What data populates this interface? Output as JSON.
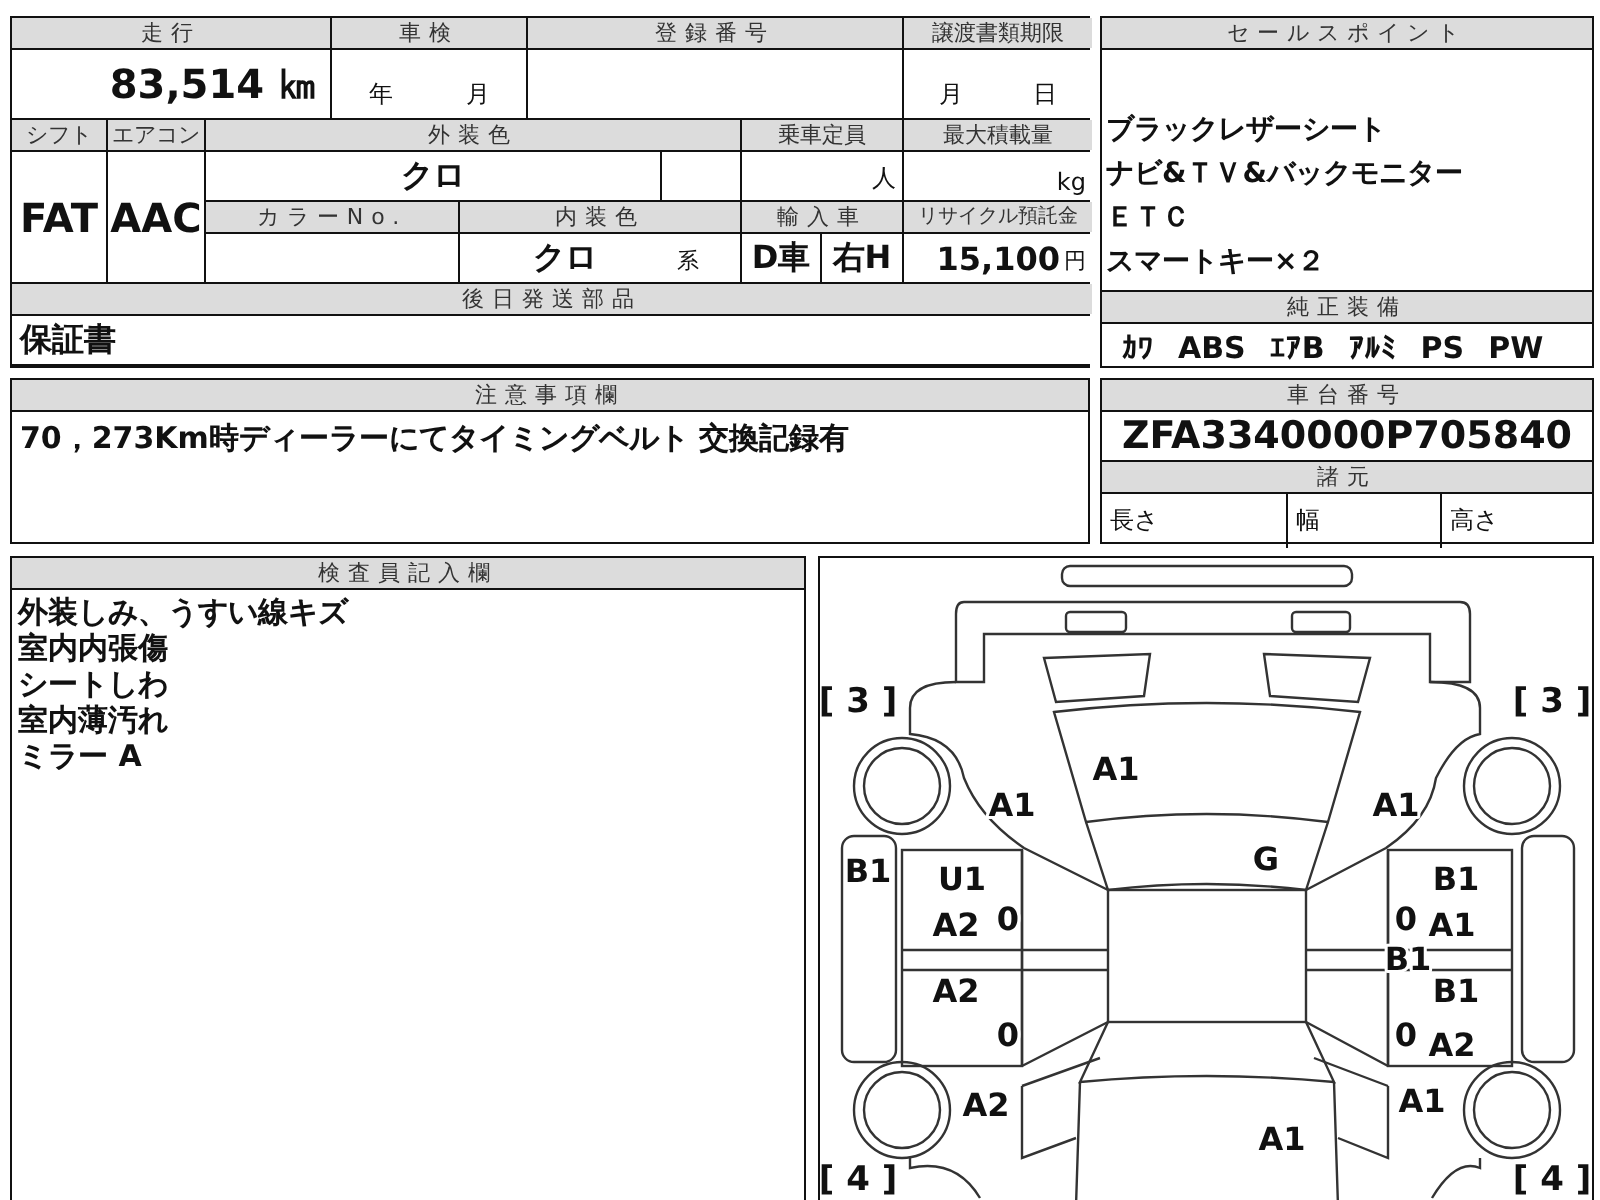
{
  "vehicle_info": {
    "mileage": {
      "label": "走行",
      "value": "83,514 ㎞"
    },
    "inspection": {
      "label": "車検",
      "year_unit": "年",
      "month_unit": "月"
    },
    "registration_number": {
      "label": "登録番号"
    },
    "transfer_deadline": {
      "label": "譲渡書類期限",
      "month_unit": "月",
      "day_unit": "日"
    },
    "shift": {
      "label": "シフト",
      "value": "FAT"
    },
    "aircon": {
      "label": "エアコン",
      "value": "AAC"
    },
    "exterior_color": {
      "label": "外装色",
      "value": "クロ"
    },
    "capacity": {
      "label": "乗車定員",
      "unit": "人"
    },
    "max_load": {
      "label": "最大積載量",
      "unit": "kg"
    },
    "color_no": {
      "label": "カラーNo."
    },
    "interior_color": {
      "label": "内装色",
      "value": "クロ",
      "unit": "系"
    },
    "import_car": {
      "label": "輸入車",
      "type": "D車",
      "handle": "右H"
    },
    "recycle_fee": {
      "label": "リサイクル預託金",
      "value": "15,100",
      "unit": "円"
    },
    "later_parts": {
      "label": "後日発送部品",
      "value": "保証書"
    }
  },
  "sale_points": {
    "label": "セールスポイント",
    "items": [
      "ブラックレザーシート",
      "ナビ&ＴＶ&バックモニター",
      "ＥＴＣ",
      "スマートキー×２"
    ]
  },
  "equipment": {
    "label": "純正装備",
    "items": [
      "ｶﾜ",
      "ABS",
      "ｴｱB",
      "ｱﾙﾐ",
      "PS",
      "PW"
    ]
  },
  "notes": {
    "label": "注意事項欄",
    "text": "70，273Km時ディーラーにてタイミングベルト 交換記録有"
  },
  "chassis": {
    "label": "車台番号",
    "value": "ZFA3340000P705840",
    "spec_label": "諸元",
    "specs": [
      "長さ",
      "幅",
      "高さ"
    ]
  },
  "inspector": {
    "label": "検査員記入欄",
    "lines": [
      "外装しみ、うすい線キズ",
      "室内内張傷",
      "シートしわ",
      "室内薄汚れ",
      "ミラー A"
    ]
  },
  "damage_diagram": {
    "tire_labels": [
      "[ 3 ]",
      "[ 3 ]",
      "[ 4 ]",
      "[ 4 ]"
    ],
    "marks": [
      "A1",
      "A1",
      "A1",
      "G",
      "B1",
      "U1",
      "A2",
      "0",
      "A2",
      "0",
      "A2",
      "A1",
      "B1",
      "0",
      "A1",
      "B1",
      "B1",
      "0",
      "A2",
      "A1"
    ]
  }
}
